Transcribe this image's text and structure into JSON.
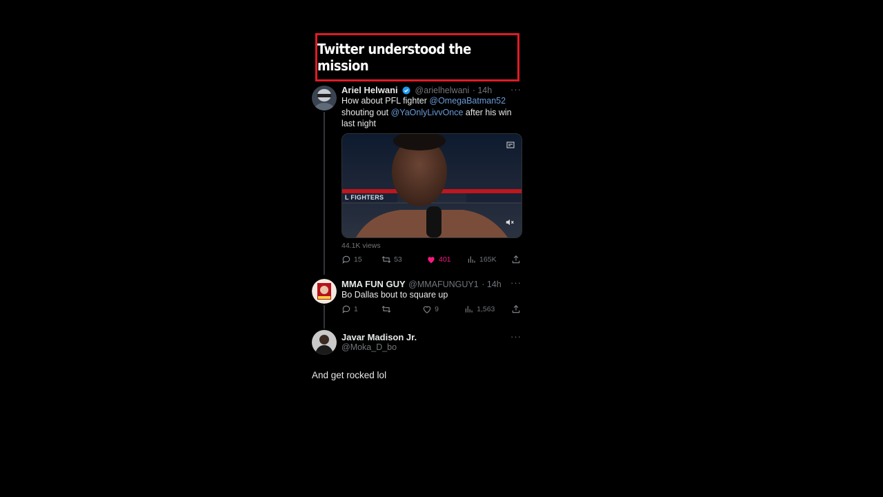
{
  "banner": {
    "text": "Twitter understood the mission"
  },
  "tweet1": {
    "name": "Ariel Helwani",
    "handle": "@arielhelwani",
    "time": "· 14h",
    "text_1": "How about PFL fighter ",
    "mention_1": "@OmegaBatman52",
    "text_2": "shouting out ",
    "mention_2": "@YaOnlyLivvOnce",
    "text_3": " after his win",
    "text_4": "last night",
    "media_banner_text": "L FIGHTERS",
    "views": "44.1K views",
    "replies": "15",
    "retweets": "53",
    "likes": "401",
    "analytics": "165K"
  },
  "tweet2": {
    "name": "MMA FUN GUY",
    "handle": "@MMAFUNGUY1",
    "time": "· 14h",
    "text": "Bo Dallas bout to square up",
    "replies": "1",
    "retweets": "",
    "likes": "9",
    "analytics": "1,563"
  },
  "tweet3": {
    "name": "Javar Madison Jr.",
    "handle": "@Moka_D_bo",
    "text": "And get rocked lol"
  },
  "colors": {
    "accent": "#1d9bf0",
    "like": "#f91880",
    "banner_border": "#e01b24",
    "muted": "#71767b"
  }
}
